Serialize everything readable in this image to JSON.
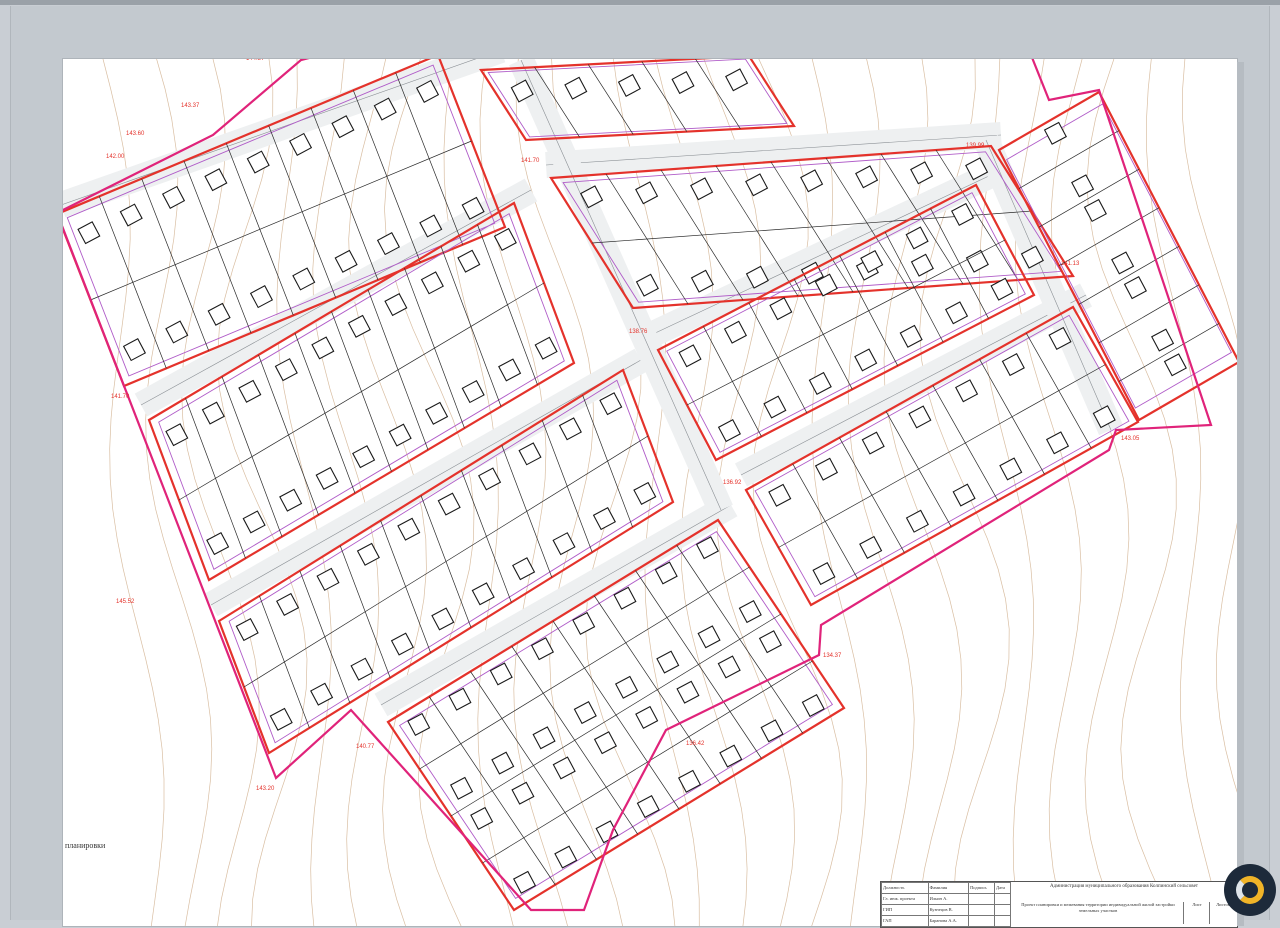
{
  "viewer": {
    "colors": {
      "background": "#c9ced4",
      "sheet": "#ffffff",
      "lot_boundary": "#e0237a",
      "block_boundary": "#e4322b",
      "setback_line": "#b05cc8",
      "road_edge": "#8a8f94",
      "contour": "#c9a27a",
      "parcel_line": "#2a2a2a"
    }
  },
  "drawing": {
    "side_label": "планировки",
    "elevation_marks": [
      "142.00",
      "143.60",
      "143.37",
      "144.37",
      "141.70",
      "145.52",
      "143.20",
      "140.77",
      "141.70",
      "138.76",
      "136.92",
      "134.37",
      "141.13",
      "143.05",
      "139.99",
      "136.42"
    ],
    "stamp": {
      "rows": [
        [
          "Должность",
          "Фамилия",
          "Подпись",
          "Дата"
        ],
        [
          "Гл. инж. проекта",
          "Ильин А.",
          "",
          ""
        ],
        [
          "ГИП",
          "Кузнецов В.",
          "",
          ""
        ],
        [
          "ГАП",
          "Баранова А.А.",
          "",
          ""
        ]
      ],
      "title": "Администрация муниципального образования Колпинский сельсовет",
      "subtitle": "Проект планировки и межевания территории индивидуальной жилой застройки земельных участков",
      "sheet_label": "Лист",
      "sheets_label": "Листов"
    }
  }
}
